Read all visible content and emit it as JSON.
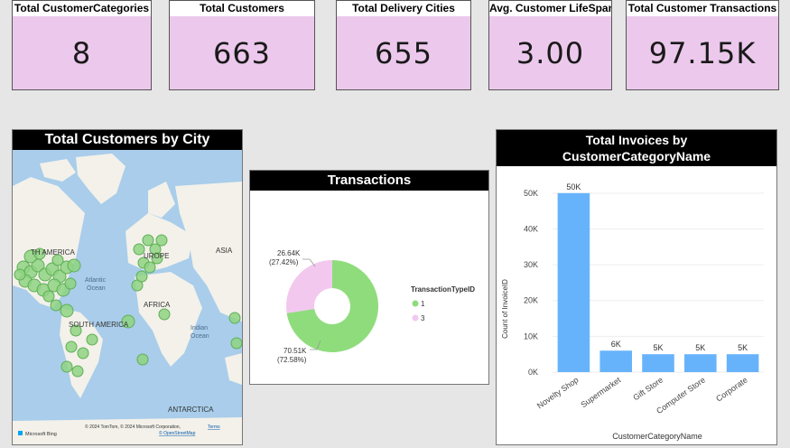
{
  "cards": [
    {
      "title": "Total CustomerCategories",
      "value": "8"
    },
    {
      "title": "Total Customers",
      "value": "663"
    },
    {
      "title": "Total Delivery Cities",
      "value": "655"
    },
    {
      "title": "Avg. Customer LifeSpan",
      "value": "3.00"
    },
    {
      "title": "Total Customer Transactions",
      "value": "97.15K"
    }
  ],
  "map": {
    "title": "Total Customers by City",
    "labels": {
      "north_america": "TH AMERICA",
      "europe": "UROPE",
      "asia": "ASIA",
      "africa": "AFRICA",
      "south_america": "SOUTH AMERICA",
      "antarctica": "ANTARCTICA",
      "atlantic": "Atlantic",
      "atlantic2": "Ocean",
      "indian": "Indian",
      "indian2": "Ocean"
    },
    "credit_logo": "Microsoft Bing",
    "credit_line1": "© 2024 TomTom, © 2024 Microsoft Corporation,",
    "credit_terms": "Terms",
    "credit_line2": "© OpenStreetMap",
    "colors": {
      "ocean": "#a9cdea",
      "land": "#f3f1ea",
      "bubble": "#8ed383",
      "bubble_stroke": "#5fae55"
    }
  },
  "donut": {
    "title": "Transactions",
    "legend_title": "TransactionTypeID",
    "segments": [
      {
        "label": "1",
        "value": 70.51,
        "display": "70.51K",
        "pct": "(72.58%)",
        "color": "#8fdc7d"
      },
      {
        "label": "3",
        "value": 26.64,
        "display": "26.64K",
        "pct": "(27.42%)",
        "color": "#f2c8ef"
      }
    ]
  },
  "bar": {
    "title_line1": "Total Invoices by",
    "title_line2": "CustomerCategoryName",
    "color": "#67b3fb"
  },
  "chart_data": {
    "type": "bar",
    "title": "Total Invoices by CustomerCategoryName",
    "xlabel": "CustomerCategoryName",
    "ylabel": "Count of InvoiceID",
    "categories": [
      "Novelty Shop",
      "Supermarket",
      "Gift Store",
      "Computer Store",
      "Corporate"
    ],
    "values": [
      50,
      6,
      5,
      5,
      5
    ],
    "data_labels": [
      "50K",
      "6K",
      "5K",
      "5K",
      "5K"
    ],
    "yticks": [
      "0K",
      "10K",
      "20K",
      "30K",
      "40K",
      "50K"
    ],
    "ylim": [
      0,
      55
    ]
  }
}
